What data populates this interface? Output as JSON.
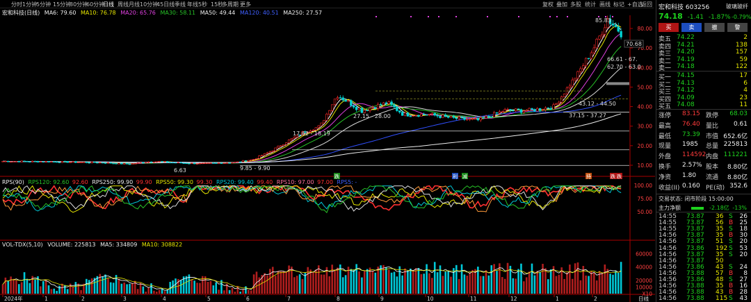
{
  "toolbar": {
    "left_items": [
      "分时",
      "1分钟",
      "5分钟",
      "15分钟",
      "30分钟",
      "60分钟",
      "日线",
      "周线",
      "月线",
      "10分钟",
      "45日线",
      "季线",
      "年线",
      "5秒",
      "15秒",
      "多周期",
      "更多"
    ],
    "active": "日线",
    "right_items": [
      "复权",
      "叠加",
      "多股",
      "统计",
      "画线",
      "标记",
      "+自选",
      "返回"
    ]
  },
  "main_legend": {
    "name": "宏和科技(日线)",
    "ma6": "MA6: 79.60",
    "ma10": "MA10: 76.78",
    "ma20": "MA20: 65.76",
    "ma30": "MA30: 58.11",
    "ma50": "MA50: 49.44",
    "ma120": "MA120: 40.51",
    "ma250": "MA250: 27.57"
  },
  "main_axis": [
    "80.00",
    "70.00",
    "60.00",
    "50.00",
    "40.00",
    "30.00",
    "20.00",
    "10.00"
  ],
  "annotations": {
    "high": "85.83",
    "cur_box": "70.68",
    "a1": "66.61 - 67.",
    "a2": "62.70 - 63.0",
    "a3": "43.12 - 44.50",
    "a4": "37.15 - 37.27",
    "a5": "27.15 - 28.00",
    "a6": "17.62 - 18.19",
    "a7": "9.85 - 9.90",
    "a8": "6.63"
  },
  "signal_tags": [
    "跌",
    "利",
    "减",
    "持",
    "跌",
    "跌"
  ],
  "rps_legend": {
    "name": "RPS(90)",
    "rps120": "RPS120: 92.60",
    "rps120b": "92.60",
    "rps250": "RPS250: 99.90",
    "rps250b": "99.90",
    "rps50": "RPS50: 99.30",
    "rps50b": "99.30",
    "rps20": "RPS20: 99.40",
    "rps20b": "99.40",
    "rps10": "RPS10: 97.00",
    "rps10b": "97.00",
    "rps5": "RPS5: -"
  },
  "rps_axis": [
    "100.00",
    "75.00",
    "50.00"
  ],
  "vol_legend": {
    "name": "VOL-TDX(5,10)",
    "volume": "VOLUME: 225813",
    "ma5": "MA5: 334809",
    "ma10": "MA10: 308822"
  },
  "vol_axis": [
    "60000",
    "40000",
    "20000",
    "10000",
    "X10"
  ],
  "date_axis": [
    "2024年",
    "1",
    "2",
    "3",
    "4",
    "5",
    "6",
    "7",
    "8",
    "9",
    "10",
    "11",
    "12",
    "1",
    "2"
  ],
  "date_right": "日线",
  "stock": {
    "name": "宏和科技 603256",
    "price": "74.18",
    "change": "-1.41",
    "pct": "-1.87%",
    "sector": "玻璃玻纤",
    "sector_pct": "-0.79%",
    "buttons": [
      "买",
      "卖",
      "撤",
      "警"
    ]
  },
  "asks": [
    {
      "label": "卖五",
      "price": "74.22",
      "vol": "2"
    },
    {
      "label": "卖四",
      "price": "74.21",
      "vol": "138"
    },
    {
      "label": "卖三",
      "price": "74.20",
      "vol": "157"
    },
    {
      "label": "卖二",
      "price": "74.19",
      "vol": "59"
    },
    {
      "label": "卖一",
      "price": "74.18",
      "vol": "122"
    }
  ],
  "bids": [
    {
      "label": "买一",
      "price": "74.15",
      "vol": "17"
    },
    {
      "label": "买二",
      "price": "74.13",
      "vod": "",
      "vol": "6"
    },
    {
      "label": "买三",
      "price": "74.12",
      "vol": "4"
    },
    {
      "label": "买四",
      "price": "74.09",
      "vol": "23"
    },
    {
      "label": "买五",
      "price": "74.08",
      "vol": "11"
    }
  ],
  "stats": [
    {
      "k1": "涨停",
      "v1": "83.15",
      "k2": "跌停",
      "v2": "68.03"
    },
    {
      "k1": "最高",
      "v1": "76.40",
      "k2": "量比",
      "v2": "0.61"
    },
    {
      "k1": "最低",
      "v1": "73.39",
      "k2": "市值",
      "v2": "652.6亿"
    },
    {
      "k1": "现量",
      "v1": "1985",
      "k2": "总量",
      "v2": "225813"
    },
    {
      "k1": "外盘",
      "v1": "114592",
      "k2": "内盘",
      "v2": "111221"
    },
    {
      "k1": "换手",
      "v1": "2.57%",
      "k2": "股本",
      "v2": "8.80亿"
    },
    {
      "k1": "净资",
      "v1": "1.80",
      "k2": "流通",
      "v2": "8.80亿"
    },
    {
      "k1": "收益(II)",
      "v1": "0.160",
      "k2": "PE(动)",
      "v2": "352.6"
    }
  ],
  "status": "交易状态: 闭市阶段 15:00:00",
  "net_flow": {
    "label": "主力净额",
    "value": "-2.18亿",
    "pct": "-13%"
  },
  "ticks": [
    {
      "t": "14:55",
      "p": "73.87",
      "v": "36",
      "d": "S",
      "n": "26"
    },
    {
      "t": "14:55",
      "p": "73.87",
      "v": "56",
      "d": "B",
      "n": "25"
    },
    {
      "t": "14:55",
      "p": "73.87",
      "v": "35",
      "d": "S",
      "n": "18"
    },
    {
      "t": "14:56",
      "p": "73.87",
      "v": "35",
      "d": "B",
      "n": "30"
    },
    {
      "t": "14:56",
      "p": "73.87",
      "v": "51",
      "d": "S",
      "n": "20"
    },
    {
      "t": "14:56",
      "p": "73.86",
      "v": "192",
      "d": "S",
      "n": "53"
    },
    {
      "t": "14:56",
      "p": "73.87",
      "v": "35",
      "d": "S",
      "n": "20"
    },
    {
      "t": "14:56",
      "p": "73.87",
      "v": "50",
      "d": "",
      "n": ""
    },
    {
      "t": "14:56",
      "p": "73.86",
      "v": "43",
      "d": "S",
      "n": "24"
    },
    {
      "t": "14:56",
      "p": "73.88",
      "v": "57",
      "d": "B",
      "n": "8"
    },
    {
      "t": "14:56",
      "p": "73.86",
      "v": "48",
      "d": "S",
      "n": "27"
    },
    {
      "t": "14:56",
      "p": "73.88",
      "v": "35",
      "d": "B",
      "n": "16"
    },
    {
      "t": "14:56",
      "p": "73.88",
      "v": "43",
      "d": "B",
      "n": "28"
    },
    {
      "t": "14:56",
      "p": "73.88",
      "v": "115",
      "d": "S",
      "n": "43"
    }
  ]
}
